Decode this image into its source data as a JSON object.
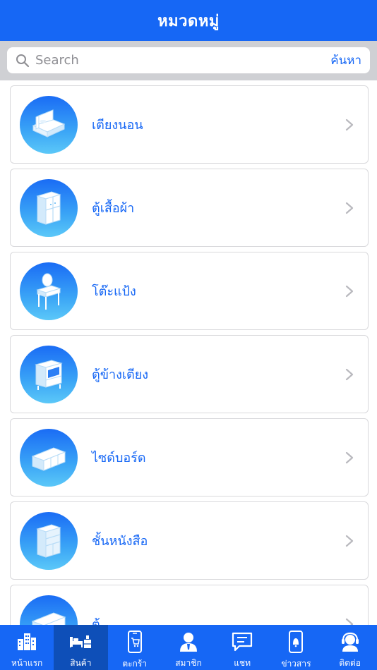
{
  "header": {
    "title": "หมวดหมู่"
  },
  "search": {
    "placeholder": "Search",
    "submit_label": "ค้นหา",
    "icon": "search-icon"
  },
  "categories": [
    {
      "label": "เตียงนอน",
      "icon": "bed-icon"
    },
    {
      "label": "ตู้เสื้อผ้า",
      "icon": "wardrobe-icon"
    },
    {
      "label": "โต๊ะแป้ง",
      "icon": "dressing-table-icon"
    },
    {
      "label": "ตู้ข้างเตียง",
      "icon": "nightstand-icon"
    },
    {
      "label": "ไซด์บอร์ด",
      "icon": "sideboard-icon"
    },
    {
      "label": "ชั้นหนังสือ",
      "icon": "bookshelf-icon"
    },
    {
      "label": "ตู้",
      "icon": "cabinet-icon"
    }
  ],
  "tabbar": {
    "active": "สินค้า",
    "tabs": [
      {
        "label": "หน้าแรก",
        "icon": "building-icon"
      },
      {
        "label": "สินค้า",
        "icon": "furniture-icon"
      },
      {
        "label": "ตะกร้า",
        "icon": "cart-phone-icon"
      },
      {
        "label": "สมาชิก",
        "icon": "member-icon"
      },
      {
        "label": "แชท",
        "icon": "chat-icon"
      },
      {
        "label": "ข่าวสาร",
        "icon": "news-bell-icon"
      },
      {
        "label": "ติดต่อ",
        "icon": "support-icon"
      }
    ]
  },
  "colors": {
    "primary": "#1667f5",
    "active_tab": "#0e4fb8",
    "search_bg": "#cfd0d4",
    "card_border": "#d9d9dc"
  }
}
